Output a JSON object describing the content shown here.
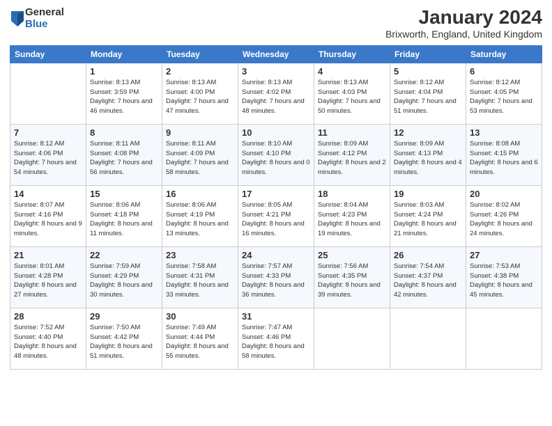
{
  "logo": {
    "general": "General",
    "blue": "Blue"
  },
  "title": {
    "month_year": "January 2024",
    "location": "Brixworth, England, United Kingdom"
  },
  "headers": [
    "Sunday",
    "Monday",
    "Tuesday",
    "Wednesday",
    "Thursday",
    "Friday",
    "Saturday"
  ],
  "weeks": [
    [
      {
        "day": "",
        "sunrise": "",
        "sunset": "",
        "daylight": ""
      },
      {
        "day": "1",
        "sunrise": "Sunrise: 8:13 AM",
        "sunset": "Sunset: 3:59 PM",
        "daylight": "Daylight: 7 hours and 46 minutes."
      },
      {
        "day": "2",
        "sunrise": "Sunrise: 8:13 AM",
        "sunset": "Sunset: 4:00 PM",
        "daylight": "Daylight: 7 hours and 47 minutes."
      },
      {
        "day": "3",
        "sunrise": "Sunrise: 8:13 AM",
        "sunset": "Sunset: 4:02 PM",
        "daylight": "Daylight: 7 hours and 48 minutes."
      },
      {
        "day": "4",
        "sunrise": "Sunrise: 8:13 AM",
        "sunset": "Sunset: 4:03 PM",
        "daylight": "Daylight: 7 hours and 50 minutes."
      },
      {
        "day": "5",
        "sunrise": "Sunrise: 8:12 AM",
        "sunset": "Sunset: 4:04 PM",
        "daylight": "Daylight: 7 hours and 51 minutes."
      },
      {
        "day": "6",
        "sunrise": "Sunrise: 8:12 AM",
        "sunset": "Sunset: 4:05 PM",
        "daylight": "Daylight: 7 hours and 53 minutes."
      }
    ],
    [
      {
        "day": "7",
        "sunrise": "Sunrise: 8:12 AM",
        "sunset": "Sunset: 4:06 PM",
        "daylight": "Daylight: 7 hours and 54 minutes."
      },
      {
        "day": "8",
        "sunrise": "Sunrise: 8:11 AM",
        "sunset": "Sunset: 4:08 PM",
        "daylight": "Daylight: 7 hours and 56 minutes."
      },
      {
        "day": "9",
        "sunrise": "Sunrise: 8:11 AM",
        "sunset": "Sunset: 4:09 PM",
        "daylight": "Daylight: 7 hours and 58 minutes."
      },
      {
        "day": "10",
        "sunrise": "Sunrise: 8:10 AM",
        "sunset": "Sunset: 4:10 PM",
        "daylight": "Daylight: 8 hours and 0 minutes."
      },
      {
        "day": "11",
        "sunrise": "Sunrise: 8:09 AM",
        "sunset": "Sunset: 4:12 PM",
        "daylight": "Daylight: 8 hours and 2 minutes."
      },
      {
        "day": "12",
        "sunrise": "Sunrise: 8:09 AM",
        "sunset": "Sunset: 4:13 PM",
        "daylight": "Daylight: 8 hours and 4 minutes."
      },
      {
        "day": "13",
        "sunrise": "Sunrise: 8:08 AM",
        "sunset": "Sunset: 4:15 PM",
        "daylight": "Daylight: 8 hours and 6 minutes."
      }
    ],
    [
      {
        "day": "14",
        "sunrise": "Sunrise: 8:07 AM",
        "sunset": "Sunset: 4:16 PM",
        "daylight": "Daylight: 8 hours and 9 minutes."
      },
      {
        "day": "15",
        "sunrise": "Sunrise: 8:06 AM",
        "sunset": "Sunset: 4:18 PM",
        "daylight": "Daylight: 8 hours and 11 minutes."
      },
      {
        "day": "16",
        "sunrise": "Sunrise: 8:06 AM",
        "sunset": "Sunset: 4:19 PM",
        "daylight": "Daylight: 8 hours and 13 minutes."
      },
      {
        "day": "17",
        "sunrise": "Sunrise: 8:05 AM",
        "sunset": "Sunset: 4:21 PM",
        "daylight": "Daylight: 8 hours and 16 minutes."
      },
      {
        "day": "18",
        "sunrise": "Sunrise: 8:04 AM",
        "sunset": "Sunset: 4:23 PM",
        "daylight": "Daylight: 8 hours and 19 minutes."
      },
      {
        "day": "19",
        "sunrise": "Sunrise: 8:03 AM",
        "sunset": "Sunset: 4:24 PM",
        "daylight": "Daylight: 8 hours and 21 minutes."
      },
      {
        "day": "20",
        "sunrise": "Sunrise: 8:02 AM",
        "sunset": "Sunset: 4:26 PM",
        "daylight": "Daylight: 8 hours and 24 minutes."
      }
    ],
    [
      {
        "day": "21",
        "sunrise": "Sunrise: 8:01 AM",
        "sunset": "Sunset: 4:28 PM",
        "daylight": "Daylight: 8 hours and 27 minutes."
      },
      {
        "day": "22",
        "sunrise": "Sunrise: 7:59 AM",
        "sunset": "Sunset: 4:29 PM",
        "daylight": "Daylight: 8 hours and 30 minutes."
      },
      {
        "day": "23",
        "sunrise": "Sunrise: 7:58 AM",
        "sunset": "Sunset: 4:31 PM",
        "daylight": "Daylight: 8 hours and 33 minutes."
      },
      {
        "day": "24",
        "sunrise": "Sunrise: 7:57 AM",
        "sunset": "Sunset: 4:33 PM",
        "daylight": "Daylight: 8 hours and 36 minutes."
      },
      {
        "day": "25",
        "sunrise": "Sunrise: 7:56 AM",
        "sunset": "Sunset: 4:35 PM",
        "daylight": "Daylight: 8 hours and 39 minutes."
      },
      {
        "day": "26",
        "sunrise": "Sunrise: 7:54 AM",
        "sunset": "Sunset: 4:37 PM",
        "daylight": "Daylight: 8 hours and 42 minutes."
      },
      {
        "day": "27",
        "sunrise": "Sunrise: 7:53 AM",
        "sunset": "Sunset: 4:38 PM",
        "daylight": "Daylight: 8 hours and 45 minutes."
      }
    ],
    [
      {
        "day": "28",
        "sunrise": "Sunrise: 7:52 AM",
        "sunset": "Sunset: 4:40 PM",
        "daylight": "Daylight: 8 hours and 48 minutes."
      },
      {
        "day": "29",
        "sunrise": "Sunrise: 7:50 AM",
        "sunset": "Sunset: 4:42 PM",
        "daylight": "Daylight: 8 hours and 51 minutes."
      },
      {
        "day": "30",
        "sunrise": "Sunrise: 7:49 AM",
        "sunset": "Sunset: 4:44 PM",
        "daylight": "Daylight: 8 hours and 55 minutes."
      },
      {
        "day": "31",
        "sunrise": "Sunrise: 7:47 AM",
        "sunset": "Sunset: 4:46 PM",
        "daylight": "Daylight: 8 hours and 58 minutes."
      },
      {
        "day": "",
        "sunrise": "",
        "sunset": "",
        "daylight": ""
      },
      {
        "day": "",
        "sunrise": "",
        "sunset": "",
        "daylight": ""
      },
      {
        "day": "",
        "sunrise": "",
        "sunset": "",
        "daylight": ""
      }
    ]
  ]
}
